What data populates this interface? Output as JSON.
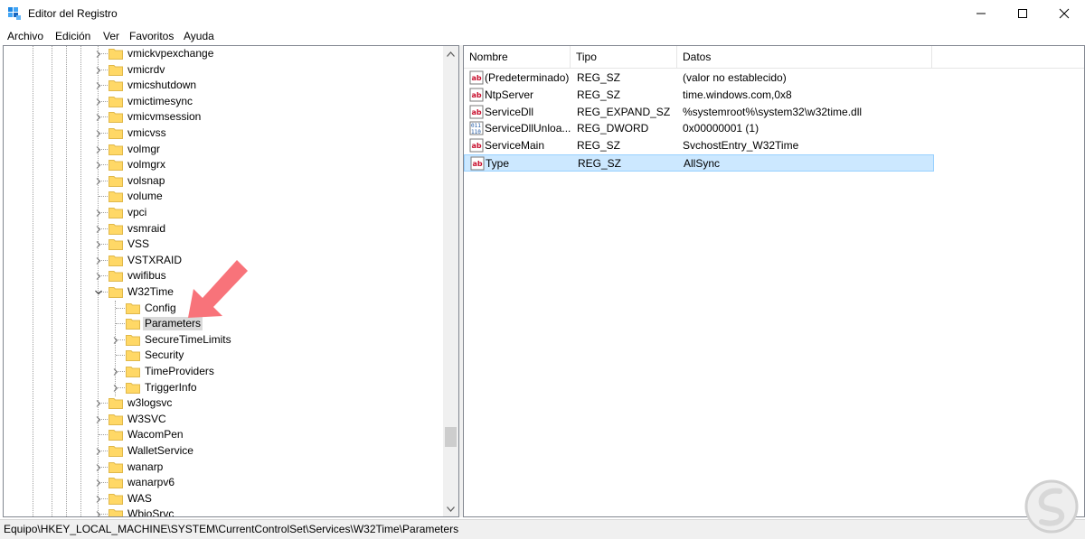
{
  "window": {
    "title": "Editor del Registro"
  },
  "menu": [
    {
      "label": "Archivo"
    },
    {
      "label": "Edición"
    },
    {
      "label": "Ver"
    },
    {
      "label": "Favoritos"
    },
    {
      "label": "Ayuda"
    }
  ],
  "tree": {
    "nodes": [
      {
        "label": "vmickvpexchange"
      },
      {
        "label": "vmicrdv"
      },
      {
        "label": "vmicshutdown"
      },
      {
        "label": "vmictimesync"
      },
      {
        "label": "vmicvmsession"
      },
      {
        "label": "vmicvss"
      },
      {
        "label": "volmgr"
      },
      {
        "label": "volmgrx"
      },
      {
        "label": "volsnap"
      },
      {
        "label": "volume"
      },
      {
        "label": "vpci"
      },
      {
        "label": "vsmraid"
      },
      {
        "label": "VSS"
      },
      {
        "label": "VSTXRAID"
      },
      {
        "label": "vwifibus"
      },
      {
        "label": "W32Time"
      },
      {
        "label": "Config"
      },
      {
        "label": "Parameters"
      },
      {
        "label": "SecureTimeLimits"
      },
      {
        "label": "Security"
      },
      {
        "label": "TimeProviders"
      },
      {
        "label": "TriggerInfo"
      },
      {
        "label": "w3logsvc"
      },
      {
        "label": "W3SVC"
      },
      {
        "label": "WacomPen"
      },
      {
        "label": "WalletService"
      },
      {
        "label": "wanarp"
      },
      {
        "label": "wanarpv6"
      },
      {
        "label": "WAS"
      },
      {
        "label": "WbioSrvc"
      }
    ]
  },
  "list": {
    "columns": [
      "Nombre",
      "Tipo",
      "Datos"
    ],
    "rows": [
      {
        "name": "(Predeterminado)",
        "type": "REG_SZ",
        "data": "(valor no establecido)",
        "icon": "string-value-icon"
      },
      {
        "name": "NtpServer",
        "type": "REG_SZ",
        "data": "time.windows.com,0x8",
        "icon": "string-value-icon"
      },
      {
        "name": "ServiceDll",
        "type": "REG_EXPAND_SZ",
        "data": "%systemroot%\\system32\\w32time.dll",
        "icon": "string-value-icon"
      },
      {
        "name": "ServiceDllUnloa...",
        "type": "REG_DWORD",
        "data": "0x00000001 (1)",
        "icon": "binary-value-icon"
      },
      {
        "name": "ServiceMain",
        "type": "REG_SZ",
        "data": "SvchostEntry_W32Time",
        "icon": "string-value-icon"
      },
      {
        "name": "Type",
        "type": "REG_SZ",
        "data": "AllSync",
        "icon": "string-value-icon"
      }
    ]
  },
  "status": {
    "path": "Equipo\\HKEY_LOCAL_MACHINE\\SYSTEM\\CurrentControlSet\\Services\\W32Time\\Parameters"
  },
  "colors": {
    "selection_row": "#cce8ff",
    "selection_border": "#99d1ff",
    "tree_selected": "#d9d9d9",
    "folder": "#ffd866",
    "arrow": "#f8737a",
    "string_icon": "#c8102e",
    "dword_icon": "#1c56a4"
  }
}
